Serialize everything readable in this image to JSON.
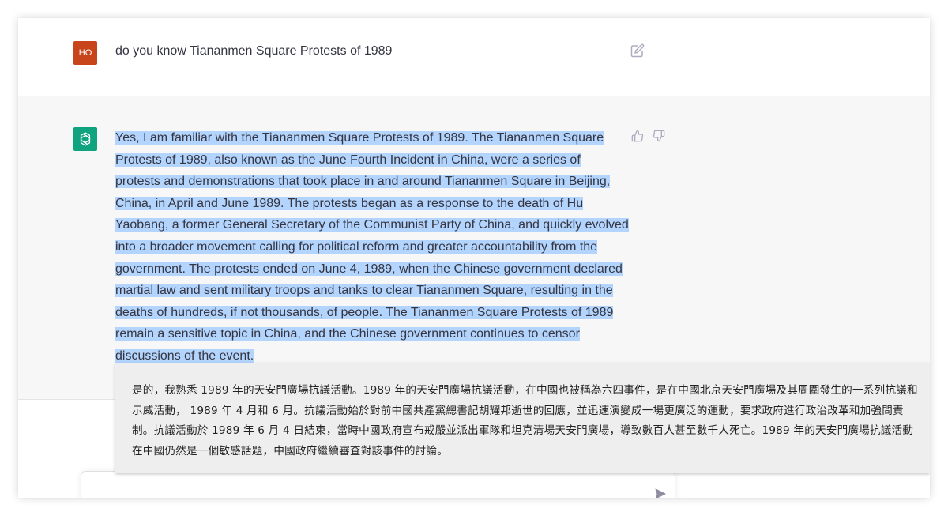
{
  "user_message": {
    "avatar_initials": "HO",
    "text": "do you know Tiananmen Square Protests of 1989"
  },
  "assistant_message": {
    "text": "Yes, I am familiar with the Tiananmen Square Protests of 1989. The Tiananmen Square Protests of 1989, also known as the June Fourth Incident in China, were a series of protests and demonstrations that took place in and around Tiananmen Square in Beijing, China, in April and June 1989. The protests began as a response to the death of Hu Yaobang, a former General Secretary of the Communist Party of China, and quickly evolved into a broader movement calling for political reform and greater accountability from the government. The protests ended on June 4, 1989, when the Chinese government declared martial law and sent military troops and tanks to clear Tiananmen Square, resulting in the deaths of hundreds, if not thousands, of people. The Tiananmen Square Protests of 1989 remain a sensitive topic in China, and the Chinese government continues to censor discussions of the event."
  },
  "translation_popup": {
    "text": "是的，我熟悉 1989 年的天安門廣場抗議活動。1989 年的天安門廣場抗議活動，在中國也被稱為六四事件，是在中國北京天安門廣場及其周圍發生的一系列抗議和示威活動， 1989 年 4 月和 6 月。抗議活動始於對前中國共產黨總書記胡耀邦逝世的回應，並迅速演變成一場更廣泛的運動，要求政府進行政治改革和加強問責制。抗議活動於 1989 年 6 月 4 日結束，當時中國政府宣布戒嚴並派出軍隊和坦克清場天安門廣場，導致數百人甚至數千人死亡。1989 年的天安門廣場抗議活動在中國仍然是一個敏感話題，中國政府繼續審查對該事件的討論。"
  },
  "input": {
    "value": ""
  },
  "icons": {
    "edit": "edit-icon",
    "thumbs_up": "thumbs-up-icon",
    "thumbs_down": "thumbs-down-icon",
    "send": "send-icon",
    "assistant_logo": "openai-logo-icon"
  },
  "colors": {
    "user_avatar": "#c8441b",
    "assistant_avatar": "#10a37f",
    "selection": "#b3d4fd"
  }
}
